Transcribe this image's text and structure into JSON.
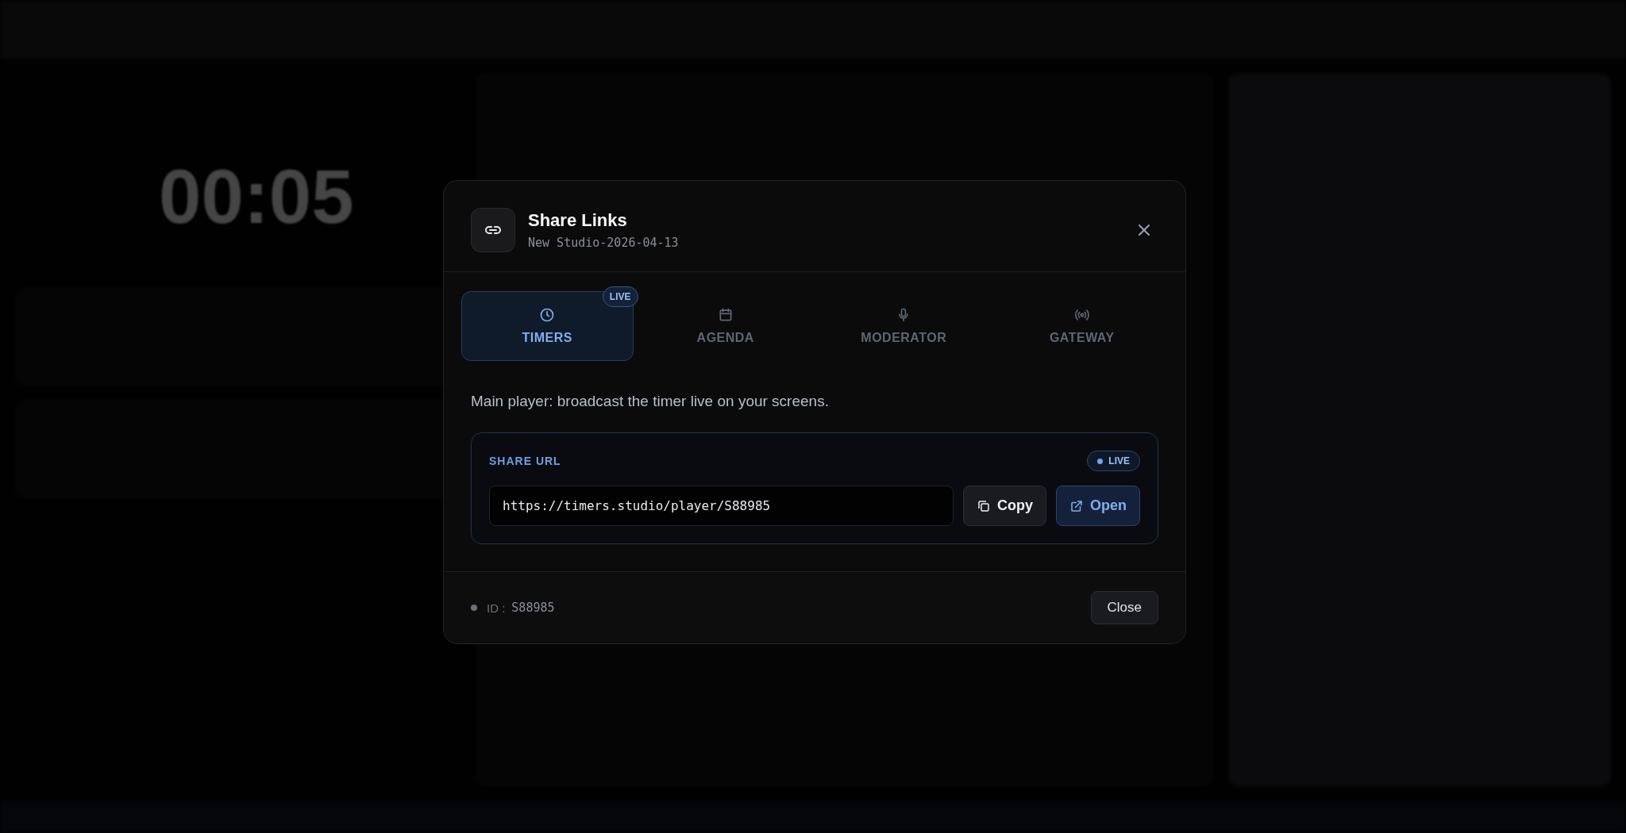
{
  "background": {
    "timer": "00:05"
  },
  "dialog": {
    "title": "Share Links",
    "subtitle": "New Studio-2026-04-13",
    "tabs": [
      {
        "label": "TIMERS",
        "kind": "clock",
        "selected": true,
        "badge": "LIVE"
      },
      {
        "label": "AGENDA",
        "kind": "calendar",
        "selected": false
      },
      {
        "label": "MODERATOR",
        "kind": "microphone",
        "selected": false
      },
      {
        "label": "GATEWAY",
        "kind": "broadcast",
        "selected": false
      }
    ],
    "description": "Main player: broadcast the timer live on your screens.",
    "share_url": {
      "label": "SHARE URL",
      "status": "LIVE",
      "value": "https://timers.studio/player/S88985",
      "buttons": [
        {
          "label": "Copy",
          "kind": "copy"
        },
        {
          "label": "Open",
          "kind": "open"
        }
      ]
    },
    "footer": {
      "id_label": "ID :",
      "id_value": "S88985",
      "close": "Close"
    }
  }
}
